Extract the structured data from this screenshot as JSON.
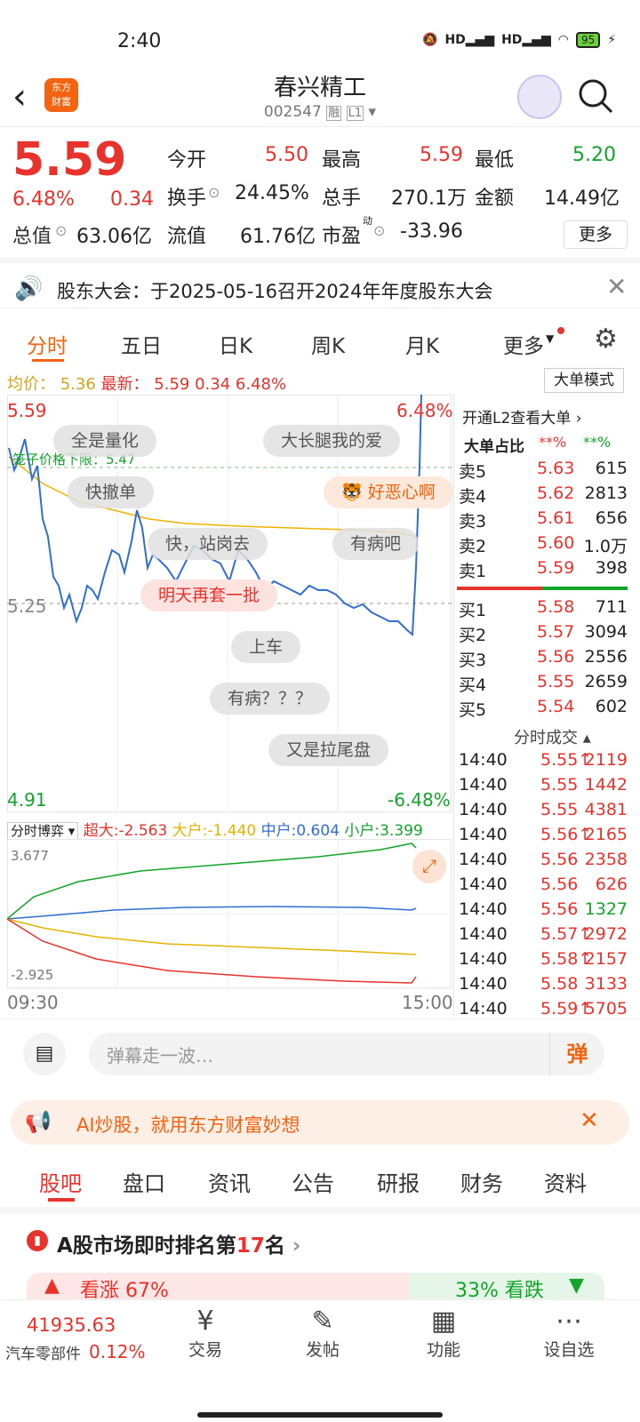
{
  "status_bar": {
    "time": "2:40",
    "battery": "95",
    "net1": "HD",
    "net2": "HD"
  },
  "header": {
    "title": "春兴精工",
    "code": "002547",
    "rong": "融",
    "level": "L1",
    "logo_line1": "东方",
    "logo_line2": "财富"
  },
  "quote": {
    "price": "5.59",
    "change_pct": "6.48%",
    "change": "0.34",
    "open_label": "今开",
    "open": "5.50",
    "high_label": "最高",
    "high": "5.59",
    "low_label": "最低",
    "low": "5.20",
    "turnover_label": "换手",
    "turnover": "24.45%",
    "volume_label": "总手",
    "volume": "270.1万",
    "amount_label": "金额",
    "amount": "14.49亿",
    "mcap_label": "总值",
    "mcap": "63.06亿",
    "float_label": "流值",
    "float": "61.76亿",
    "pe_label": "市盈",
    "pe_sup": "动",
    "pe": "-33.96",
    "more": "更多"
  },
  "notice": {
    "text": "股东大会：于2025-05-16召开2024年年度股东大会"
  },
  "tabs": [
    "分时",
    "五日",
    "日K",
    "周K",
    "月K",
    "更多"
  ],
  "info": {
    "avg_label": "均价：",
    "avg": "5.36",
    "latest_label": "最新：",
    "latest": "5.59",
    "chg": "0.34",
    "pct": "6.48%",
    "mode": "大单模式"
  },
  "chart": {
    "y_top": "5.59",
    "y_mid": "5.25",
    "y_bottom": "4.91",
    "pct_top": "6.48%",
    "pct_bottom": "-6.48%",
    "cage_label": "笼子价格下限：5.47",
    "time_start": "09:30",
    "time_end": "15:00"
  },
  "danmaku": [
    "全是量化",
    "大长腿我的爱",
    "快撤单",
    "好恶心啊",
    "快，站岗去",
    "有病吧",
    "明天再套一批",
    "上车",
    "有病？？？",
    "又是拉尾盘"
  ],
  "flow": {
    "label": "分时博弈",
    "super": "超大:-2.563",
    "big": "大户:-1.440",
    "mid": "中户:0.604",
    "small": "小户:3.399",
    "y_top": "3.677",
    "y_bottom": "-2.925"
  },
  "panel": {
    "l2": "开通L2查看大单",
    "ratio_label": "大单占比",
    "ratio_red": "**%",
    "ratio_green": "**%",
    "sells": [
      {
        "label": "卖5",
        "price": "5.63",
        "vol": "615"
      },
      {
        "label": "卖4",
        "price": "5.62",
        "vol": "2813"
      },
      {
        "label": "卖3",
        "price": "5.61",
        "vol": "656"
      },
      {
        "label": "卖2",
        "price": "5.60",
        "vol": "1.0万"
      },
      {
        "label": "卖1",
        "price": "5.59",
        "vol": "398"
      }
    ],
    "buys": [
      {
        "label": "买1",
        "price": "5.58",
        "vol": "711"
      },
      {
        "label": "买2",
        "price": "5.57",
        "vol": "3094"
      },
      {
        "label": "买3",
        "price": "5.56",
        "vol": "2556"
      },
      {
        "label": "买4",
        "price": "5.55",
        "vol": "2659"
      },
      {
        "label": "买5",
        "price": "5.54",
        "vol": "602"
      }
    ],
    "trades_label": "分时成交",
    "trades": [
      {
        "t": "14:40",
        "p": "5.55↑",
        "v": "2119"
      },
      {
        "t": "14:40",
        "p": "5.55",
        "v": "1442"
      },
      {
        "t": "14:40",
        "p": "5.55",
        "v": "4381"
      },
      {
        "t": "14:40",
        "p": "5.56↑",
        "v": "2165"
      },
      {
        "t": "14:40",
        "p": "5.56",
        "v": "2358"
      },
      {
        "t": "14:40",
        "p": "5.56",
        "v": "626"
      },
      {
        "t": "14:40",
        "p": "5.56",
        "v": "1327"
      },
      {
        "t": "14:40",
        "p": "5.57↑",
        "v": "2972"
      },
      {
        "t": "14:40",
        "p": "5.58↑",
        "v": "2157"
      },
      {
        "t": "14:40",
        "p": "5.58",
        "v": "3133"
      },
      {
        "t": "14:40",
        "p": "5.59↑",
        "v": "5705"
      }
    ]
  },
  "input": {
    "placeholder": "弹幕走一波…",
    "send": "弹"
  },
  "ai_banner": {
    "text": "AI炒股，就用东方财富妙想"
  },
  "news_tabs": [
    "股吧",
    "盘口",
    "资讯",
    "公告",
    "研报",
    "财务",
    "资料"
  ],
  "rank": {
    "text_pre": "A股市场即时排名第",
    "num": "17",
    "text_post": "名",
    "up": "看涨 67%",
    "down": "33% 看跌"
  },
  "bottom": {
    "index_value": "41935.63",
    "index_name": "汽车零部件",
    "index_pct": "0.12%",
    "trade": "交易",
    "post": "发帖",
    "func": "功能",
    "watch": "设自选"
  }
}
